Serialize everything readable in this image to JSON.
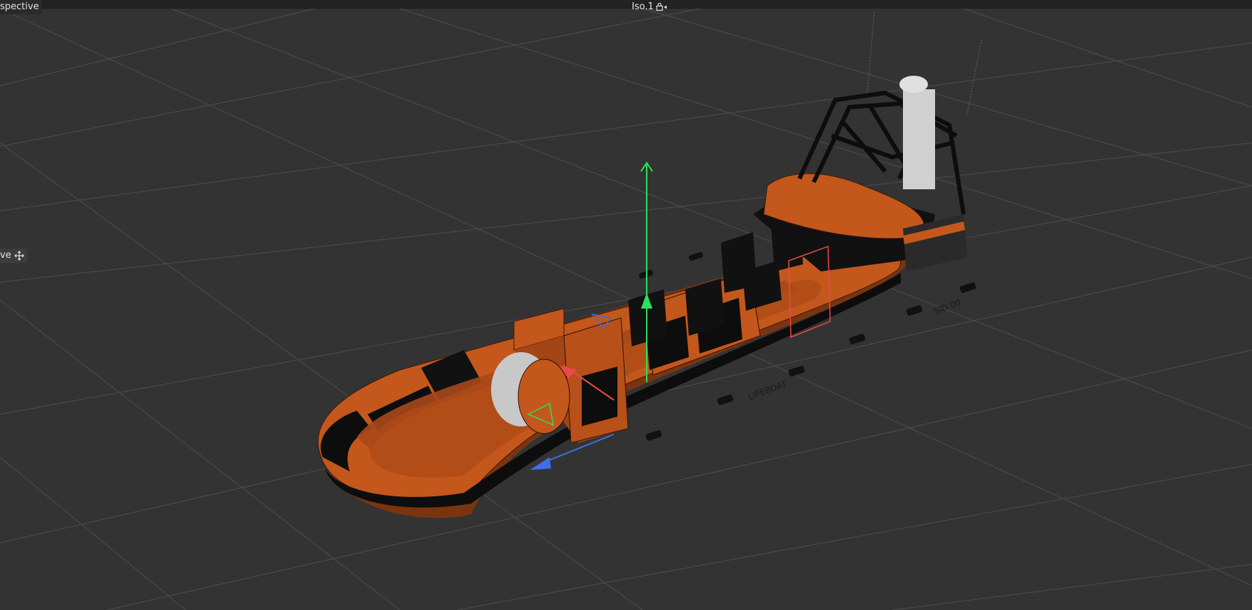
{
  "viewport": {
    "projection_label": "spective",
    "camera_label": "Iso.1",
    "tool_label": "ve",
    "colors": {
      "background": "#333333",
      "grid": "#4a4a4a",
      "hull_orange": "#c4571c",
      "hull_dark": "#0d0d0d",
      "axis_y": "#2ee05a",
      "axis_x": "#e84a4a",
      "axis_z": "#3d6fe6"
    }
  },
  "model": {
    "hull_text": "LIFEBOAT",
    "bow_code": "SID.00"
  },
  "icons": {
    "camera_lock": "lock-icon",
    "move_tool": "move-arrows-icon"
  }
}
